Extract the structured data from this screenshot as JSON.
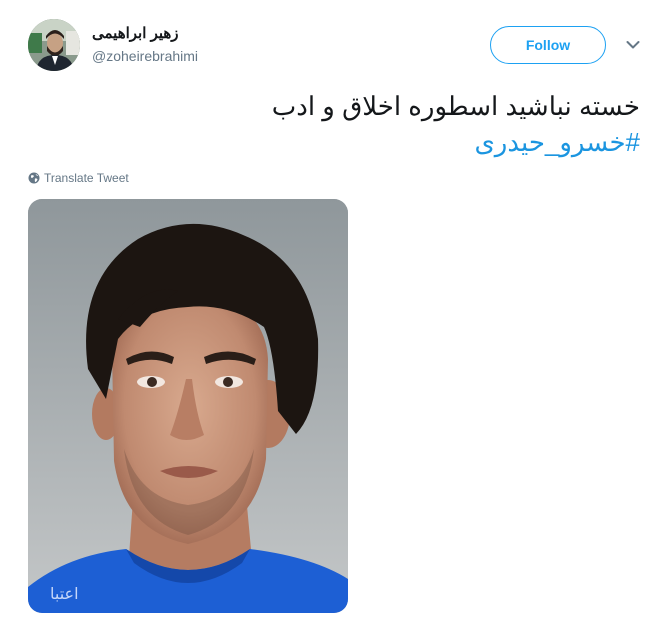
{
  "author": {
    "display_name": "زهیر ابراهیمی",
    "handle": "@zoheirebrahimi",
    "avatar_icon": "user-avatar"
  },
  "follow_button": {
    "label": "Follow"
  },
  "menu": {
    "icon": "chevron-down-icon"
  },
  "tweet": {
    "text": "خسته نباشید اسطوره اخلاق و ادب",
    "hashtag": "#خسرو_حیدری"
  },
  "translate": {
    "label": "Translate Tweet",
    "icon": "globe-icon"
  },
  "colors": {
    "accent": "#1da1f2",
    "hashtag": "#1b95e0",
    "text": "#14171a",
    "secondary": "#657786"
  }
}
